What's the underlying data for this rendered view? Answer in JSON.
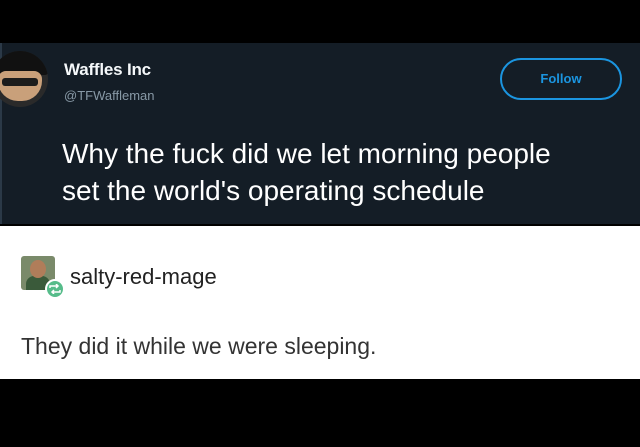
{
  "tweet": {
    "display_name": "Waffles Inc",
    "handle": "@TFWaffleman",
    "follow_label": "Follow",
    "text_lines": [
      "Why the fuck did we let morning people",
      "set the world's operating schedule"
    ]
  },
  "reply": {
    "username": "salty-red-mage",
    "text": "They did it while we were sleeping.",
    "reblog_icon": "reblog-icon"
  },
  "colors": {
    "tweet_background": "#141d26",
    "follow_accent": "#1b95e0",
    "reblog_badge": "#56bc8a",
    "reply_background": "#ffffff"
  }
}
